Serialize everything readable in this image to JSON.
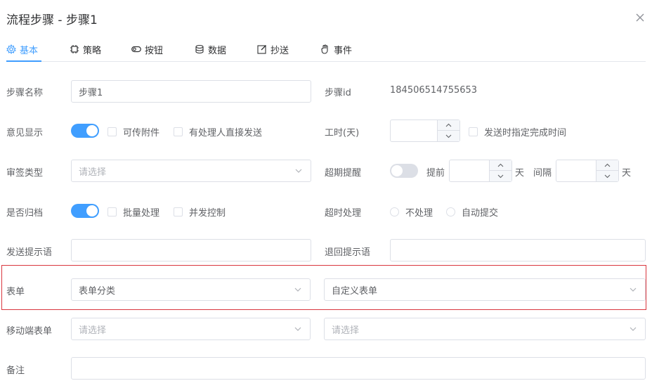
{
  "dialog": {
    "title": "流程步骤 - 步骤1"
  },
  "tabs": [
    {
      "label": "基本",
      "icon": "gear-icon",
      "active": true
    },
    {
      "label": "策略",
      "icon": "chip-icon"
    },
    {
      "label": "按钮",
      "icon": "toggle-icon"
    },
    {
      "label": "数据",
      "icon": "database-icon"
    },
    {
      "label": "抄送",
      "icon": "edit-icon"
    },
    {
      "label": "事件",
      "icon": "hand-icon"
    }
  ],
  "form": {
    "step_name": {
      "label": "步骤名称",
      "value": "步骤1"
    },
    "step_id": {
      "label": "步骤id",
      "value": "184506514755653"
    },
    "opinion": {
      "label": "意见显示",
      "switch_on": true
    },
    "attach": {
      "label": "可传附件"
    },
    "direct_send": {
      "label": "有处理人直接发送"
    },
    "work_hours": {
      "label": "工时(天)",
      "value": ""
    },
    "specify_time": {
      "label": "发送时指定完成时间"
    },
    "review_type": {
      "label": "审签类型",
      "placeholder": "请选择"
    },
    "overdue": {
      "label": "超期提醒",
      "switch_on": false
    },
    "advance": {
      "label": "提前",
      "unit": "天"
    },
    "interval": {
      "label": "间隔",
      "unit": "天"
    },
    "archive": {
      "label": "是否归档",
      "switch_on": true
    },
    "batch": {
      "label": "批量处理"
    },
    "concurrent": {
      "label": "并发控制"
    },
    "timeout": {
      "label": "超时处理",
      "options": [
        "不处理",
        "自动提交"
      ]
    },
    "send_hint": {
      "label": "发送提示语",
      "value": ""
    },
    "return_hint": {
      "label": "退回提示语",
      "value": ""
    },
    "form_field": {
      "label": "表单",
      "category": "表单分类",
      "custom": "自定义表单"
    },
    "mobile_form": {
      "label": "移动端表单",
      "placeholder": "请选择"
    },
    "remark": {
      "label": "备注",
      "value": ""
    }
  },
  "colors": {
    "accent": "#409eff",
    "highlight": "#d9363e"
  }
}
